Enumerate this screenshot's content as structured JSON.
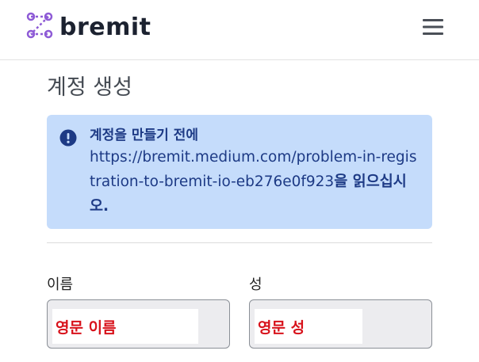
{
  "header": {
    "brand_name": "bremit",
    "brand_icon": "bremit-logo-icon",
    "menu_icon": "hamburger-menu-icon"
  },
  "page": {
    "title": "계정 생성"
  },
  "alert": {
    "icon": "exclamation-circle-icon",
    "heading": "계정을 만들기 전에",
    "link_text": "https://bremit.medium.com/problem-in-registration-to-bremit-io-eb276e0f923",
    "tail_text": "을 읽으십시오."
  },
  "form": {
    "first_name": {
      "label": "이름",
      "value": "영문 이름"
    },
    "last_name": {
      "label": "성",
      "value": "영문 성"
    }
  },
  "colors": {
    "brand_purple": "#8e5bd6",
    "alert_background": "#c5dcfb",
    "alert_text": "#1d3a85",
    "annotation_red": "#d8121b"
  }
}
